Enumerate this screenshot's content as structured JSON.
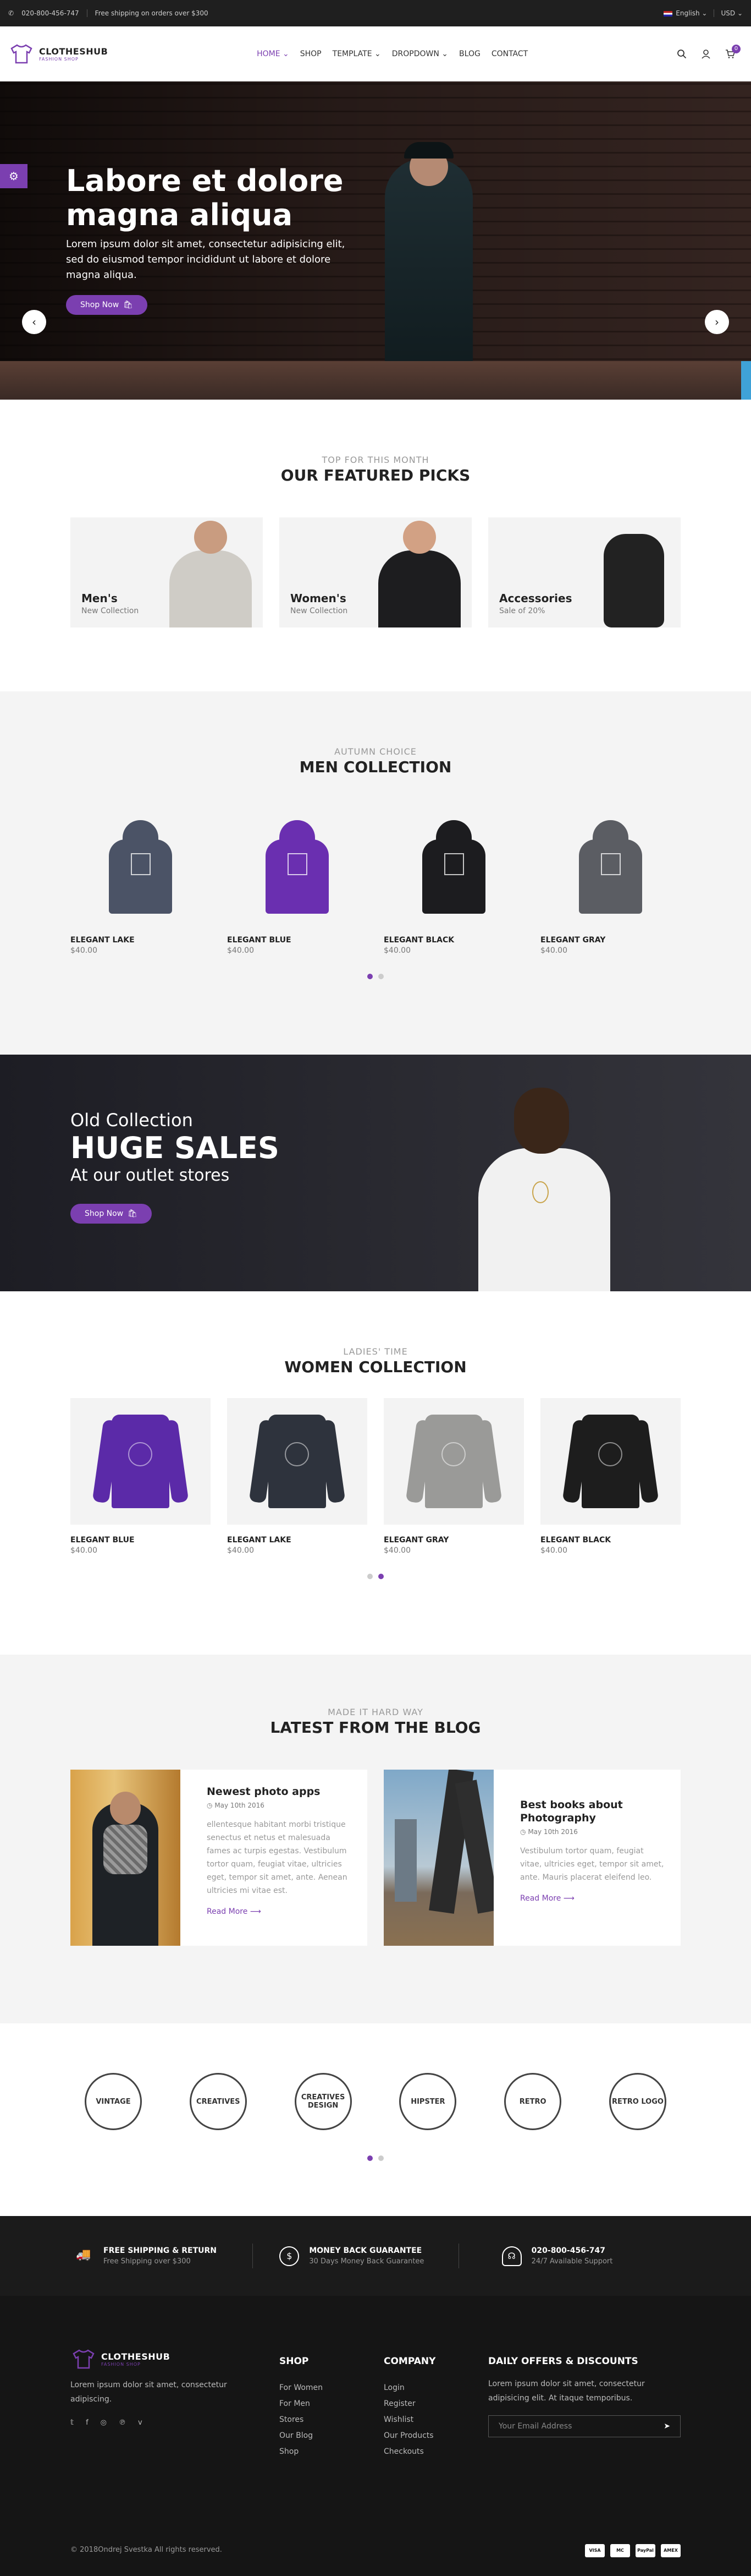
{
  "topbar": {
    "phone": "020-800-456-747",
    "shipping": "Free shipping on orders over $300",
    "language": "English",
    "currency": "USD"
  },
  "header": {
    "logo_name": "CLOTHESHUB",
    "logo_tagline": "FASHION SHOP",
    "nav": [
      "HOME",
      "SHOP",
      "TEMPLATE",
      "DROPDOWN",
      "BLOG",
      "CONTACT"
    ],
    "cart_count": "0",
    "accent": "#7b3fb0"
  },
  "hero": {
    "title": "Labore et dolore magna aliqua",
    "text": "Lorem ipsum dolor sit amet, consectetur adipisicing elit, sed do eiusmod tempor incididunt ut labore et dolore magna aliqua.",
    "button": "Shop Now",
    "prev": "‹",
    "next": "›"
  },
  "featured": {
    "subtitle": "TOP FOR THIS MONTH",
    "title": "OUR FEATURED PICKS",
    "cards": [
      {
        "name": "Men's",
        "sub": "New Collection"
      },
      {
        "name": "Women's",
        "sub": "New Collection"
      },
      {
        "name": "Accessories",
        "sub": "Sale of 20%"
      }
    ]
  },
  "men": {
    "subtitle": "AUTUMN CHOICE",
    "title": "MEN COLLECTION",
    "products": [
      {
        "name": "ELEGANT LAKE",
        "price": "$40.00",
        "color": "#4b5366"
      },
      {
        "name": "ELEGANT BLUE",
        "price": "$40.00",
        "color": "#6a2fb0"
      },
      {
        "name": "ELEGANT BLACK",
        "price": "$40.00",
        "color": "#1c1c1f"
      },
      {
        "name": "ELEGANT GRAY",
        "price": "$40.00",
        "color": "#5b5d63"
      }
    ]
  },
  "sales": {
    "line1": "Old Collection",
    "line2": "HUGE SALES",
    "line3": "At our outlet stores",
    "button": "Shop Now"
  },
  "women": {
    "subtitle": "LADIES' TIME",
    "title": "WOMEN COLLECTION",
    "products": [
      {
        "name": "ELEGANT BLUE",
        "price": "$40.00",
        "color": "#5b2aa8"
      },
      {
        "name": "ELEGANT LAKE",
        "price": "$40.00",
        "color": "#2e333d"
      },
      {
        "name": "ELEGANT GRAY",
        "price": "$40.00",
        "color": "#9a9a98"
      },
      {
        "name": "ELEGANT BLACK",
        "price": "$40.00",
        "color": "#1d1d1d"
      }
    ]
  },
  "blog": {
    "subtitle": "MADE IT HARD WAY",
    "title": "LATEST FROM THE BLOG",
    "posts": [
      {
        "title": "Newest photo apps",
        "date": "May 10th 2016",
        "text": "ellentesque habitant morbi tristique senectus et netus et malesuada fames ac turpis egestas. Vestibulum tortor quam, feugiat vitae, ultricies eget, tempor sit amet, ante. Aenean ultricies mi vitae est.",
        "link": "Read More"
      },
      {
        "title": "Best books about Photography",
        "date": "May 10th 2016",
        "text": "Vestibulum tortor quam, feugiat vitae, ultricies eget, tempor sit amet, ante. Mauris placerat eleifend leo.",
        "link": "Read More"
      }
    ]
  },
  "brands": [
    "VINTAGE",
    "CREATIVES",
    "CREATIVES DESIGN",
    "HIPSTER",
    "RETRO",
    "RETRO LOGO"
  ],
  "service": [
    {
      "title": "FREE SHIPPING & RETURN",
      "sub": "Free Shipping over $300",
      "icon": "truck-icon"
    },
    {
      "title": "MONEY BACK GUARANTEE",
      "sub": "30 Days Money Back Guarantee",
      "icon": "dollar-icon"
    },
    {
      "title": "020-800-456-747",
      "sub": "24/7 Available Support",
      "icon": "headset-icon"
    }
  ],
  "footer": {
    "desc": "Lorem ipsum dolor sit amet, consectetur adipiscing.",
    "shop_title": "SHOP",
    "shop_links": [
      "For Women",
      "For Men",
      "Stores",
      "Our Blog",
      "Shop"
    ],
    "company_title": "COMPANY",
    "company_links": [
      "Login",
      "Register",
      "Wishlist",
      "Our Products",
      "Checkouts"
    ],
    "offers_title": "DAILY OFFERS & DISCOUNTS",
    "offers_text": "Lorem ipsum dolor sit amet, consectetur adipisicing elit. At itaque temporibus.",
    "email_placeholder": "Your Email Address",
    "copyright": "© 2018Ondrej Svestka All rights reserved.",
    "payments": [
      "VISA",
      "MC",
      "PayPal",
      "AMEX"
    ]
  }
}
